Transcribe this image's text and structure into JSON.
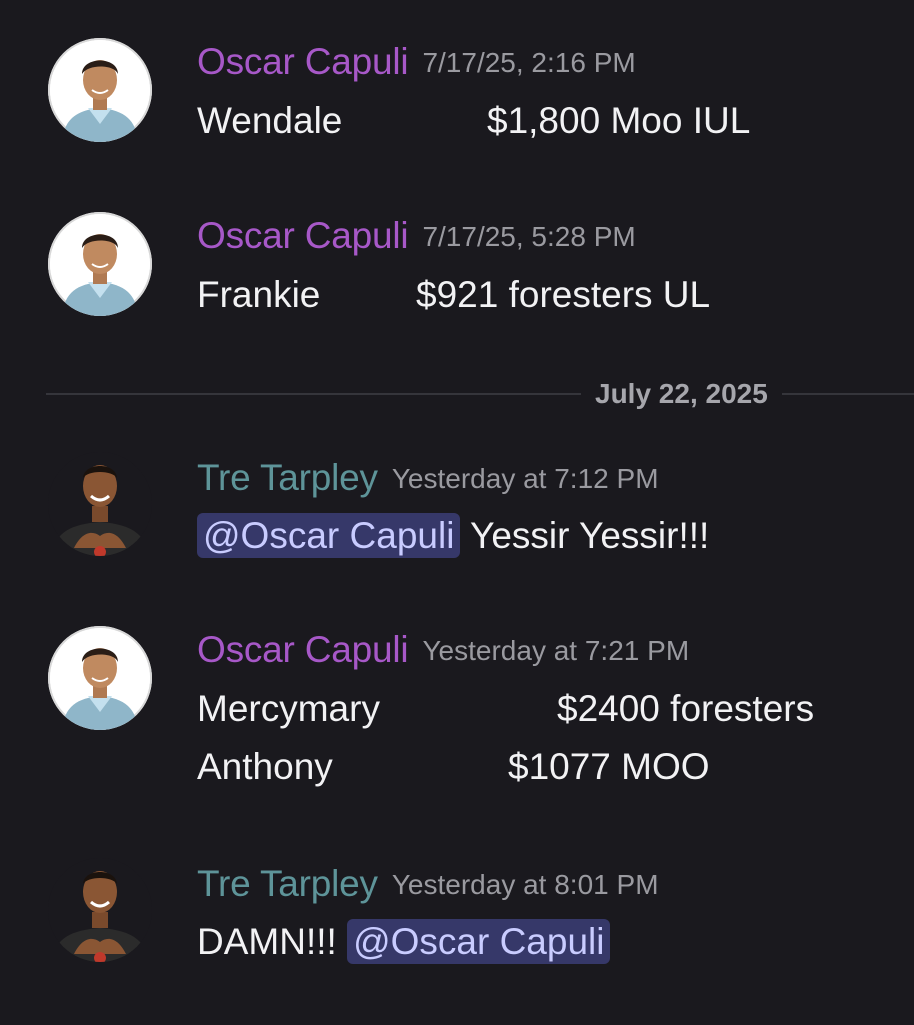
{
  "messages": [
    {
      "author": "Oscar Capuli",
      "timestamp": "7/17/25, 2:16 PM",
      "lines": [
        {
          "name": "Wendale",
          "amount": "$1,800 Moo IUL"
        }
      ]
    },
    {
      "author": "Oscar Capuli",
      "timestamp": "7/17/25, 5:28 PM",
      "lines": [
        {
          "name": "Frankie",
          "amount": "$921 foresters UL"
        }
      ]
    },
    {
      "author": "Tre Tarpley",
      "timestamp": "Yesterday at 7:12 PM",
      "mention": "@Oscar Capuli",
      "text": "Yessir Yessir!!!"
    },
    {
      "author": "Oscar Capuli",
      "timestamp": "Yesterday at 7:21 PM",
      "lines": [
        {
          "name": "Mercymary",
          "amount": "$2400 foresters"
        },
        {
          "name": "Anthony",
          "amount": "$1077 MOO"
        }
      ]
    },
    {
      "author": "Tre Tarpley",
      "timestamp": "Yesterday at 8:01 PM",
      "text_before": "DAMN!!!",
      "mention": "@Oscar Capuli"
    }
  ],
  "date_divider": "July 22, 2025",
  "colors": {
    "background": "#1a191e",
    "oscar_name": "#a758c8",
    "tre_name": "#5e9499",
    "mention_bg": "#363869",
    "mention_text": "#c9ccff"
  },
  "icons": {
    "oscar_avatar": "user-avatar-photo",
    "tre_avatar": "user-avatar-photo"
  }
}
